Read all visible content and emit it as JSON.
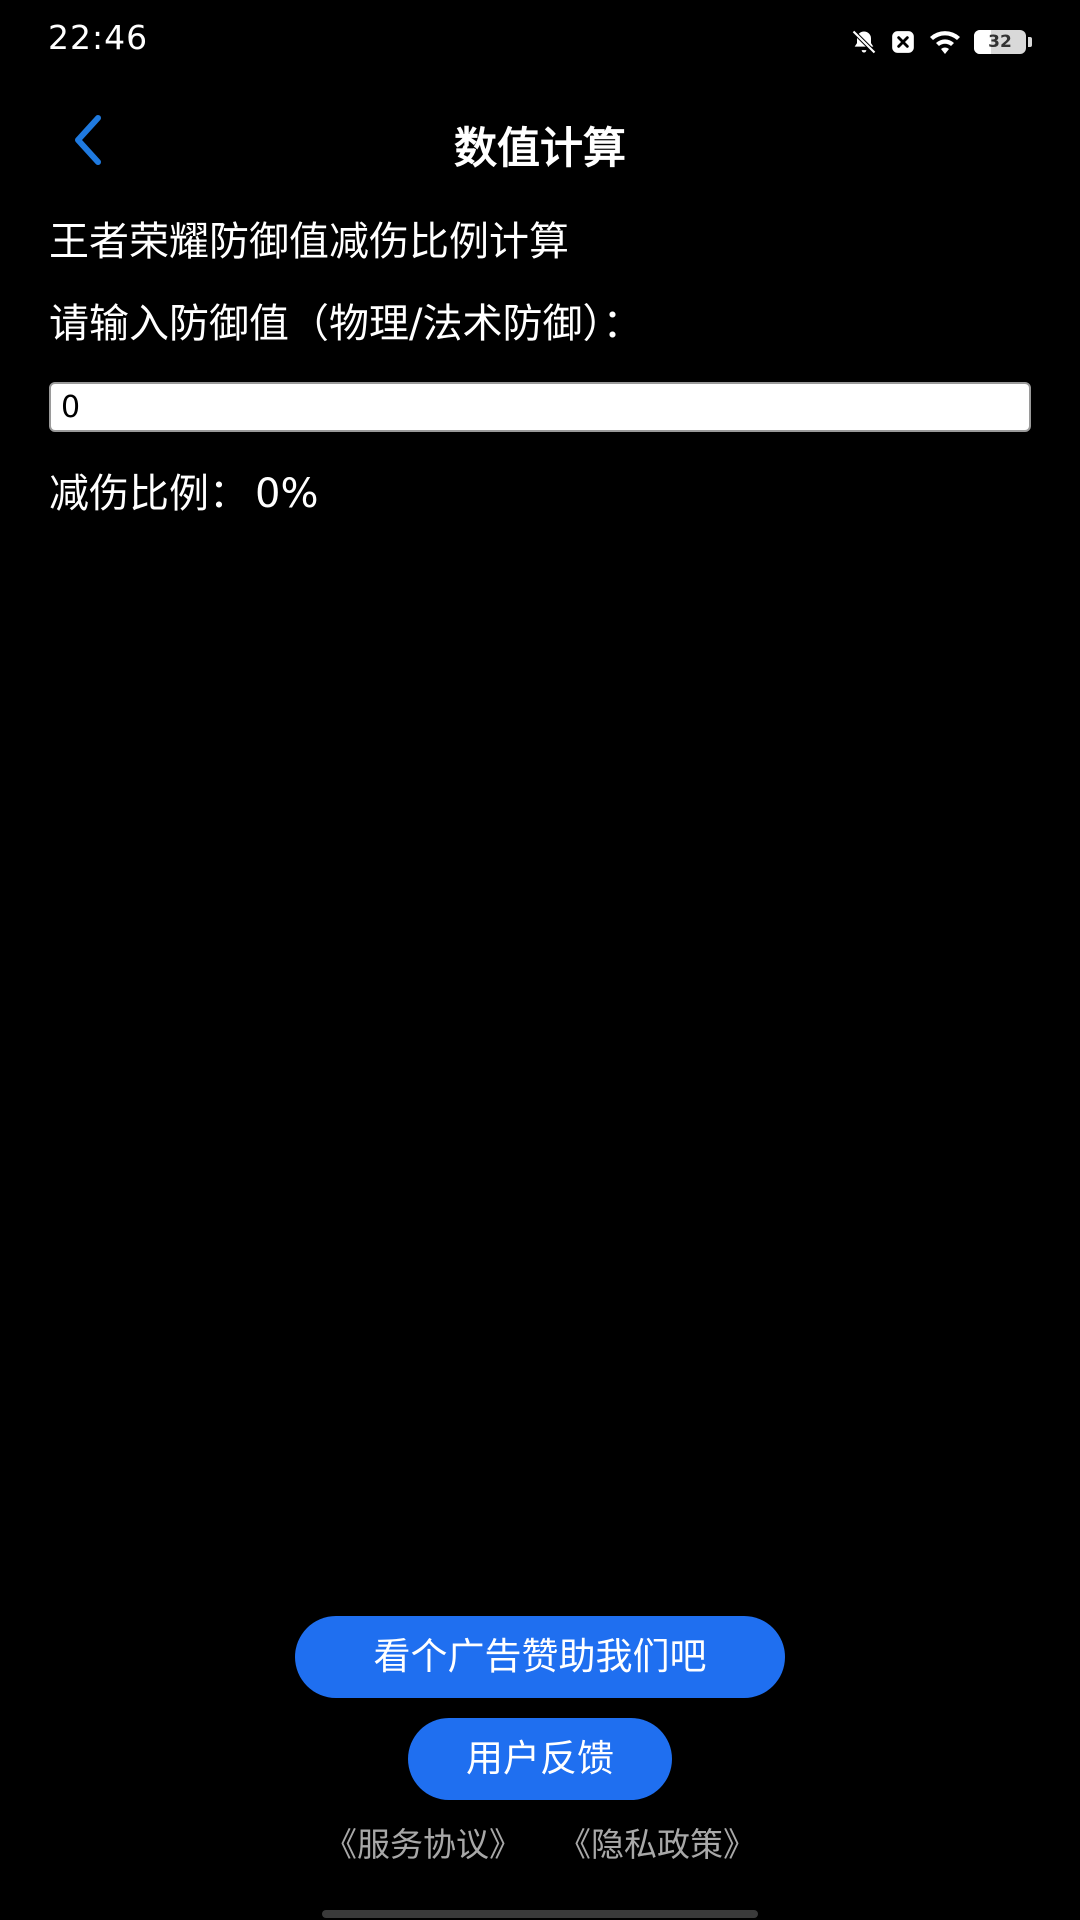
{
  "status_bar": {
    "time": "22:46",
    "icons": [
      "bell-off-icon",
      "close-box-icon",
      "wifi-icon",
      "battery-icon"
    ],
    "battery_level": "32",
    "battery_fraction": 0.32
  },
  "nav": {
    "back_icon": "chevron-left-icon",
    "title": "数值计算",
    "accent_color": "#1f7ae0"
  },
  "main": {
    "heading": "王者荣耀防御值减伤比例计算",
    "input_label": "请输入防御值（物理/法术防御）：",
    "input_value": "0",
    "result_label": "减伤比例：",
    "result_value": "0%"
  },
  "footer": {
    "ad_button_label": "看个广告赞助我们吧",
    "feedback_button_label": "用户反馈",
    "service_agreement_link": "《服务协议》",
    "privacy_policy_link": "《隐私政策》",
    "button_color": "#1f6ff0"
  }
}
